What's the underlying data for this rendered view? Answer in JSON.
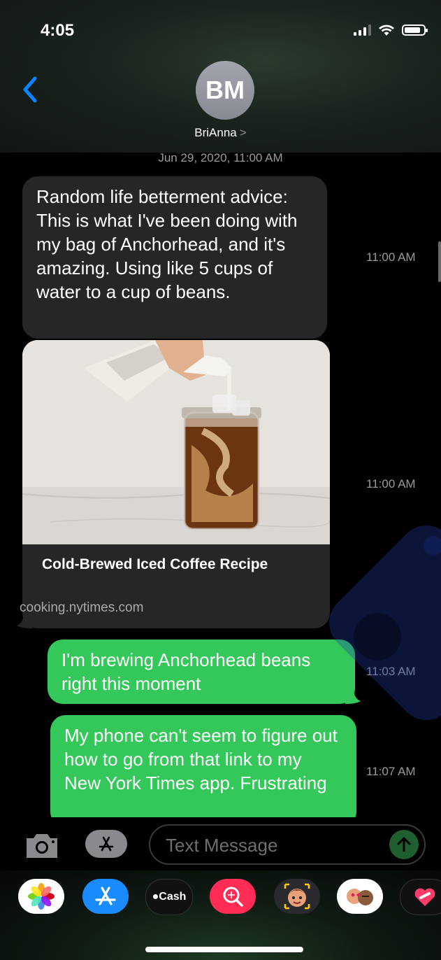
{
  "status_bar": {
    "time": "4:05"
  },
  "header": {
    "avatar_initials": "BM",
    "contact_name": "BriAnna",
    "chevron": ">"
  },
  "conversation": {
    "date": "Jun 29, 2020, 11:00 AM",
    "messages": [
      {
        "type": "received",
        "text": "Random life betterment advice: This is what I've been doing with my bag of Anchorhead, and it's amazing. Using like 5 cups of water to a cup of beans.",
        "time": "11:00 AM"
      },
      {
        "type": "received_link",
        "title": "Cold-Brewed Iced Coffee Recipe",
        "domain": "cooking.nytimes.com",
        "time": "11:00 AM"
      },
      {
        "type": "sent",
        "text": "I'm brewing Anchorhead beans right this moment",
        "time": "11:03 AM"
      },
      {
        "type": "sent",
        "text": "My phone can't seem to figure out how to go from that link to my New York Times app. Frustrating",
        "time": "11:07 AM"
      }
    ]
  },
  "composer": {
    "placeholder": "Text Message"
  },
  "app_drawer": {
    "apps": [
      {
        "name": "photos-icon"
      },
      {
        "name": "app-store-icon"
      },
      {
        "name": "apple-cash-icon",
        "label": "Cash"
      },
      {
        "name": "search-images-icon"
      },
      {
        "name": "memoji-icon"
      },
      {
        "name": "memoji-stickers-icon"
      },
      {
        "name": "digital-touch-icon"
      }
    ]
  },
  "colors": {
    "sent_bubble": "#34c759",
    "received_bubble": "#262628",
    "link_blue": "#0a84ff"
  }
}
